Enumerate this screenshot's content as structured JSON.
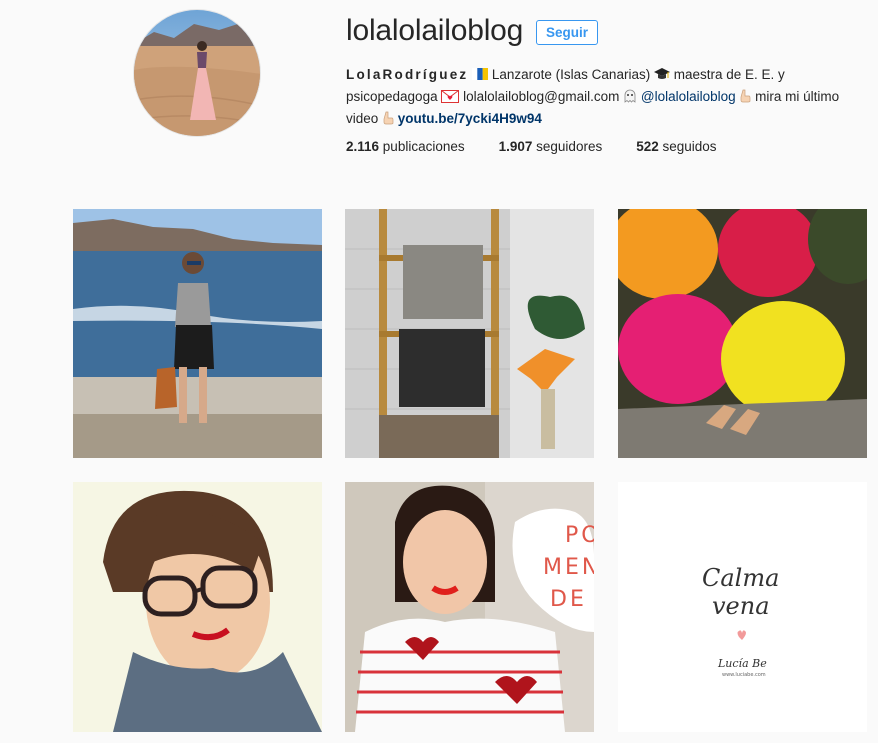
{
  "profile": {
    "username": "lolalolailoblog",
    "follow_label": "Seguir",
    "name": "LolaRodríguez",
    "bio_part1": " Lanzarote (Islas Canarias) ",
    "bio_part2": " maestra de E. E. y psicopedagoga ",
    "bio_part3": " lolalolailoblog@gmail.com ",
    "mention": "@lolalolailoblog",
    "bio_part4": " mira mi último video ",
    "link": "youtu.be/7ycki4H9w94",
    "icons": [
      "flag-canarias-icon",
      "graduation-cap-icon",
      "love-letter-icon",
      "ghost-icon",
      "pointing-hand-icon",
      "pointing-hand-icon"
    ]
  },
  "stats": {
    "posts_count": "2.116",
    "posts_label": " publicaciones",
    "followers_count": "1.907",
    "followers_label": " seguidores",
    "following_count": "522",
    "following_label": " seguidos"
  },
  "posts": {
    "post5_text_line1": "PO",
    "post5_text_line2": "MEN",
    "post5_text_line3": "DE T",
    "post6_text_line1": "Calma",
    "post6_text_line2": "vena",
    "post6_signature": "Lucía Be",
    "post6_url": "www.luciabe.com"
  },
  "colors": {
    "accent": "#3897f0",
    "link": "#003569",
    "background": "#fafafa"
  }
}
